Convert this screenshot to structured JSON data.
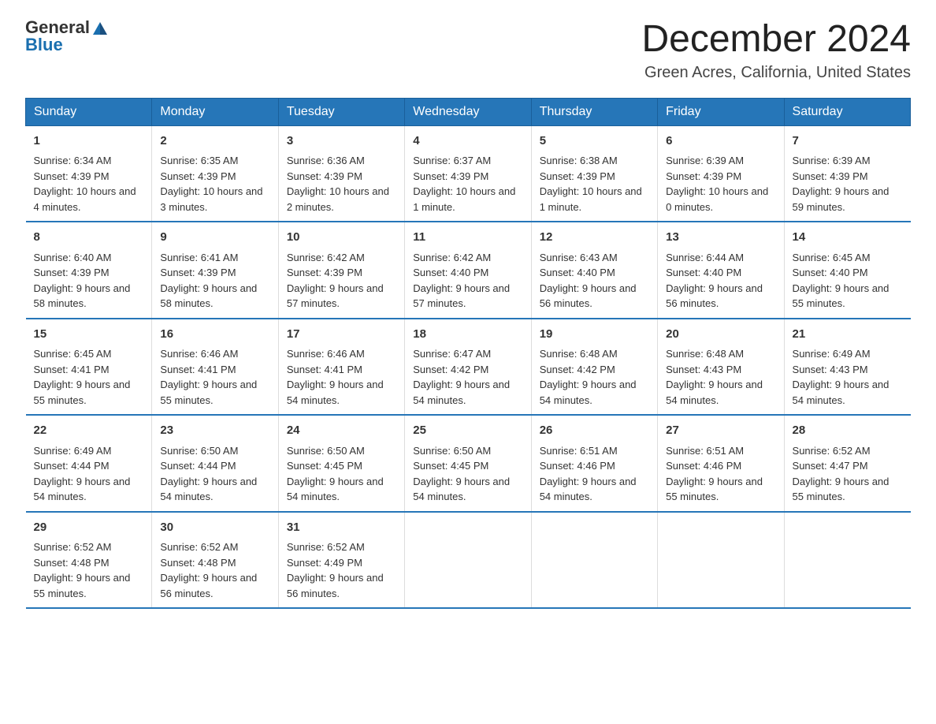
{
  "logo": {
    "general": "General",
    "blue": "Blue"
  },
  "header": {
    "month": "December 2024",
    "location": "Green Acres, California, United States"
  },
  "weekdays": [
    "Sunday",
    "Monday",
    "Tuesday",
    "Wednesday",
    "Thursday",
    "Friday",
    "Saturday"
  ],
  "weeks": [
    [
      {
        "day": "1",
        "sunrise": "6:34 AM",
        "sunset": "4:39 PM",
        "daylight": "10 hours and 4 minutes."
      },
      {
        "day": "2",
        "sunrise": "6:35 AM",
        "sunset": "4:39 PM",
        "daylight": "10 hours and 3 minutes."
      },
      {
        "day": "3",
        "sunrise": "6:36 AM",
        "sunset": "4:39 PM",
        "daylight": "10 hours and 2 minutes."
      },
      {
        "day": "4",
        "sunrise": "6:37 AM",
        "sunset": "4:39 PM",
        "daylight": "10 hours and 1 minute."
      },
      {
        "day": "5",
        "sunrise": "6:38 AM",
        "sunset": "4:39 PM",
        "daylight": "10 hours and 1 minute."
      },
      {
        "day": "6",
        "sunrise": "6:39 AM",
        "sunset": "4:39 PM",
        "daylight": "10 hours and 0 minutes."
      },
      {
        "day": "7",
        "sunrise": "6:39 AM",
        "sunset": "4:39 PM",
        "daylight": "9 hours and 59 minutes."
      }
    ],
    [
      {
        "day": "8",
        "sunrise": "6:40 AM",
        "sunset": "4:39 PM",
        "daylight": "9 hours and 58 minutes."
      },
      {
        "day": "9",
        "sunrise": "6:41 AM",
        "sunset": "4:39 PM",
        "daylight": "9 hours and 58 minutes."
      },
      {
        "day": "10",
        "sunrise": "6:42 AM",
        "sunset": "4:39 PM",
        "daylight": "9 hours and 57 minutes."
      },
      {
        "day": "11",
        "sunrise": "6:42 AM",
        "sunset": "4:40 PM",
        "daylight": "9 hours and 57 minutes."
      },
      {
        "day": "12",
        "sunrise": "6:43 AM",
        "sunset": "4:40 PM",
        "daylight": "9 hours and 56 minutes."
      },
      {
        "day": "13",
        "sunrise": "6:44 AM",
        "sunset": "4:40 PM",
        "daylight": "9 hours and 56 minutes."
      },
      {
        "day": "14",
        "sunrise": "6:45 AM",
        "sunset": "4:40 PM",
        "daylight": "9 hours and 55 minutes."
      }
    ],
    [
      {
        "day": "15",
        "sunrise": "6:45 AM",
        "sunset": "4:41 PM",
        "daylight": "9 hours and 55 minutes."
      },
      {
        "day": "16",
        "sunrise": "6:46 AM",
        "sunset": "4:41 PM",
        "daylight": "9 hours and 55 minutes."
      },
      {
        "day": "17",
        "sunrise": "6:46 AM",
        "sunset": "4:41 PM",
        "daylight": "9 hours and 54 minutes."
      },
      {
        "day": "18",
        "sunrise": "6:47 AM",
        "sunset": "4:42 PM",
        "daylight": "9 hours and 54 minutes."
      },
      {
        "day": "19",
        "sunrise": "6:48 AM",
        "sunset": "4:42 PM",
        "daylight": "9 hours and 54 minutes."
      },
      {
        "day": "20",
        "sunrise": "6:48 AM",
        "sunset": "4:43 PM",
        "daylight": "9 hours and 54 minutes."
      },
      {
        "day": "21",
        "sunrise": "6:49 AM",
        "sunset": "4:43 PM",
        "daylight": "9 hours and 54 minutes."
      }
    ],
    [
      {
        "day": "22",
        "sunrise": "6:49 AM",
        "sunset": "4:44 PM",
        "daylight": "9 hours and 54 minutes."
      },
      {
        "day": "23",
        "sunrise": "6:50 AM",
        "sunset": "4:44 PM",
        "daylight": "9 hours and 54 minutes."
      },
      {
        "day": "24",
        "sunrise": "6:50 AM",
        "sunset": "4:45 PM",
        "daylight": "9 hours and 54 minutes."
      },
      {
        "day": "25",
        "sunrise": "6:50 AM",
        "sunset": "4:45 PM",
        "daylight": "9 hours and 54 minutes."
      },
      {
        "day": "26",
        "sunrise": "6:51 AM",
        "sunset": "4:46 PM",
        "daylight": "9 hours and 54 minutes."
      },
      {
        "day": "27",
        "sunrise": "6:51 AM",
        "sunset": "4:46 PM",
        "daylight": "9 hours and 55 minutes."
      },
      {
        "day": "28",
        "sunrise": "6:52 AM",
        "sunset": "4:47 PM",
        "daylight": "9 hours and 55 minutes."
      }
    ],
    [
      {
        "day": "29",
        "sunrise": "6:52 AM",
        "sunset": "4:48 PM",
        "daylight": "9 hours and 55 minutes."
      },
      {
        "day": "30",
        "sunrise": "6:52 AM",
        "sunset": "4:48 PM",
        "daylight": "9 hours and 56 minutes."
      },
      {
        "day": "31",
        "sunrise": "6:52 AM",
        "sunset": "4:49 PM",
        "daylight": "9 hours and 56 minutes."
      },
      null,
      null,
      null,
      null
    ]
  ]
}
